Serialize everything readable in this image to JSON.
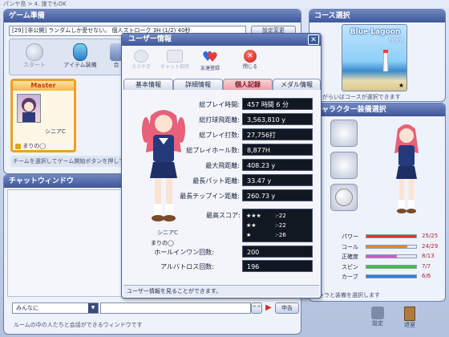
{
  "window_title": "パンヤ島 > 4. 誰でもOK",
  "game_prep": {
    "title": "ゲーム準備",
    "room_info": "[29] [非公開] ランダムしか愛せない。 個人ストローク 3H (1/2) 40秒",
    "settings_btn": "設定変更",
    "start_label": "スタート",
    "item_label": "アイテム装備",
    "pair_label": "合",
    "master_label": "Master",
    "player_name": "シニアC",
    "owner_name": "まりの◯",
    "hint": "チームを選択してゲーム開始ボタンを押して"
  },
  "chat": {
    "title": "チャットウィンドウ",
    "channel": "みんなに",
    "input_value": "",
    "toggle": "^^",
    "send": "申告",
    "footer": "ルームの中の人たちと会話ができるウィンドウです"
  },
  "course": {
    "title": "コース選択",
    "course_name": "Blue Lagoon",
    "course_sub": "Front",
    "hint": "ークがらいばコースが選択できます"
  },
  "equip": {
    "title": "キャラクター装備選択",
    "stats": [
      {
        "name": "パワー",
        "value": "25/25",
        "fill": 1.0,
        "color": "#e0342b"
      },
      {
        "name": "コール",
        "value": "24/29",
        "fill": 0.83,
        "color": "#e08a2a"
      },
      {
        "name": "正確度",
        "value": "8/13",
        "fill": 0.62,
        "color": "#cc5cc4"
      },
      {
        "name": "スピン",
        "value": "7/7",
        "fill": 1.0,
        "color": "#3fbf3f"
      },
      {
        "name": "カーブ",
        "value": "6/6",
        "fill": 1.0,
        "color": "#2f7fe0"
      }
    ],
    "footer": "キャラと装備を選択します",
    "settings_label": "設定",
    "exit_label": "退室"
  },
  "user_info": {
    "title": "ユーザー情報",
    "close_x": "✕",
    "toolbar": {
      "whisper": "ささやき",
      "chat_invite": "チャット招待",
      "friend": "友達登録",
      "close": "閉じる"
    },
    "tabs": [
      "基本情報",
      "詳細情報",
      "個人記録",
      "メダル情報"
    ],
    "active_tab": 2,
    "char_name": "シニアC",
    "owner": "まりの◯",
    "records": [
      {
        "label": "総プレイ時間:",
        "value": "457 時間 6 分"
      },
      {
        "label": "総打球飛距離:",
        "value": "3,563,810 y"
      },
      {
        "label": "総プレイ打数:",
        "value": "27,756打"
      },
      {
        "label": "総プレイホール数:",
        "value": "8,877H"
      },
      {
        "label": "最大飛距離:",
        "value": "408.23 y"
      },
      {
        "label": "最長パット距離:",
        "value": "33.47 y"
      },
      {
        "label": "最長チップイン距離:",
        "value": "260.73 y"
      }
    ],
    "best_score_label": "最高スコア:",
    "best_scores": [
      {
        "stars": "★★★",
        "score": ":-22"
      },
      {
        "stars": "★★",
        "score": ":-22"
      },
      {
        "stars": "★",
        "score": ":-26"
      }
    ],
    "hole_in_one_label": "ホールインワン回数:",
    "hole_in_one_value": "200",
    "albatross_label": "アルバトロス回数:",
    "albatross_value": "196",
    "footer": "ユーザー情報を見ることができます。"
  }
}
